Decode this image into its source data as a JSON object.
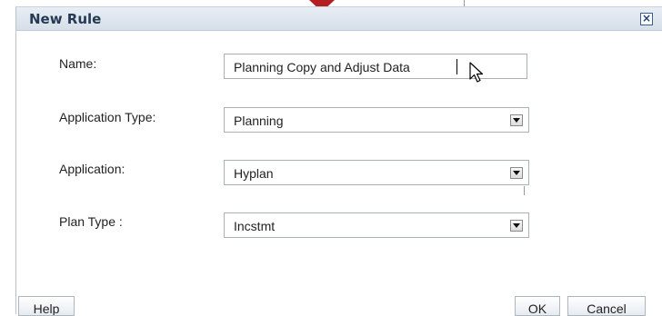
{
  "dialog": {
    "title": "New Rule",
    "close_label": "×"
  },
  "form": {
    "name": {
      "label": "Name:",
      "value": "Planning Copy and Adjust Data"
    },
    "application_type": {
      "label": "Application Type:",
      "value": "Planning"
    },
    "application": {
      "label": "Application:",
      "value": "Hyplan"
    },
    "plan_type": {
      "label": "Plan Type :",
      "value": "Incstmt"
    }
  },
  "footer": {
    "help_label": "Help",
    "ok_label": "OK",
    "cancel_label": "Cancel"
  },
  "colors": {
    "title_text": "#253a54",
    "titlebar": "#dbe3ec",
    "marker": "#b41f24"
  },
  "icons": {
    "close": "close-icon",
    "dropdown": "chevron-down-icon",
    "pointer": "mouse-pointer-icon"
  }
}
